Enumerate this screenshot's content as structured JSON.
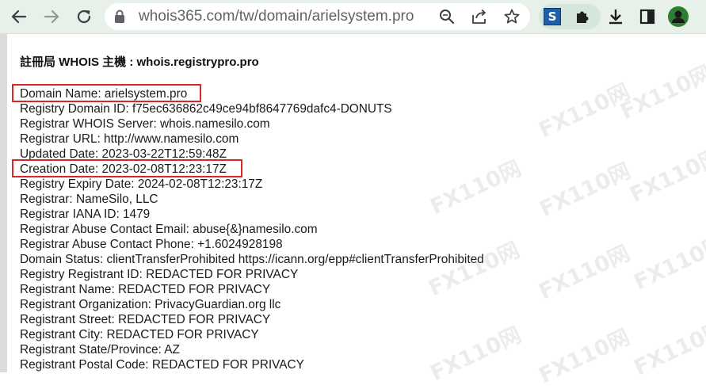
{
  "browser": {
    "url": "whois365.com/tw/domain/arielsystem.pro",
    "extension_badge": "S",
    "accent_color": "#1e5fa8",
    "toolbar_color": "#e8f0ea",
    "icons": [
      "back-arrow-icon",
      "forward-arrow-icon",
      "reload-icon",
      "lock-icon",
      "zoom-icon",
      "share-icon",
      "bookmark-star-icon",
      "puzzle-icon",
      "download-icon",
      "side-panel-icon",
      "profile-icon"
    ]
  },
  "page": {
    "heading_label": "註冊局 WHOIS 主機 :",
    "heading_value": "whois.registrypro.pro",
    "highlight_color": "#d9262b",
    "lines": [
      "Domain Name: arielsystem.pro",
      "Registry Domain ID: f75ec636862c49ce94bf8647769dafc4-DONUTS",
      "Registrar WHOIS Server: whois.namesilo.com",
      "Registrar URL: http://www.namesilo.com",
      "Updated Date: 2023-03-22T12:59:48Z",
      "Creation Date: 2023-02-08T12:23:17Z",
      "Registry Expiry Date: 2024-02-08T12:23:17Z",
      "Registrar: NameSilo, LLC",
      "Registrar IANA ID: 1479",
      "Registrar Abuse Contact Email: abuse{&}namesilo.com",
      "Registrar Abuse Contact Phone: +1.6024928198",
      "Domain Status: clientTransferProhibited https://icann.org/epp#clientTransferProhibited",
      "Registry Registrant ID: REDACTED FOR PRIVACY",
      "Registrant Name: REDACTED FOR PRIVACY",
      "Registrant Organization: PrivacyGuardian.org llc",
      "Registrant Street: REDACTED FOR PRIVACY",
      "Registrant City: REDACTED FOR PRIVACY",
      "Registrant State/Province: AZ",
      "Registrant Postal Code: REDACTED FOR PRIVACY"
    ]
  },
  "watermark": {
    "text": "FX110网"
  }
}
